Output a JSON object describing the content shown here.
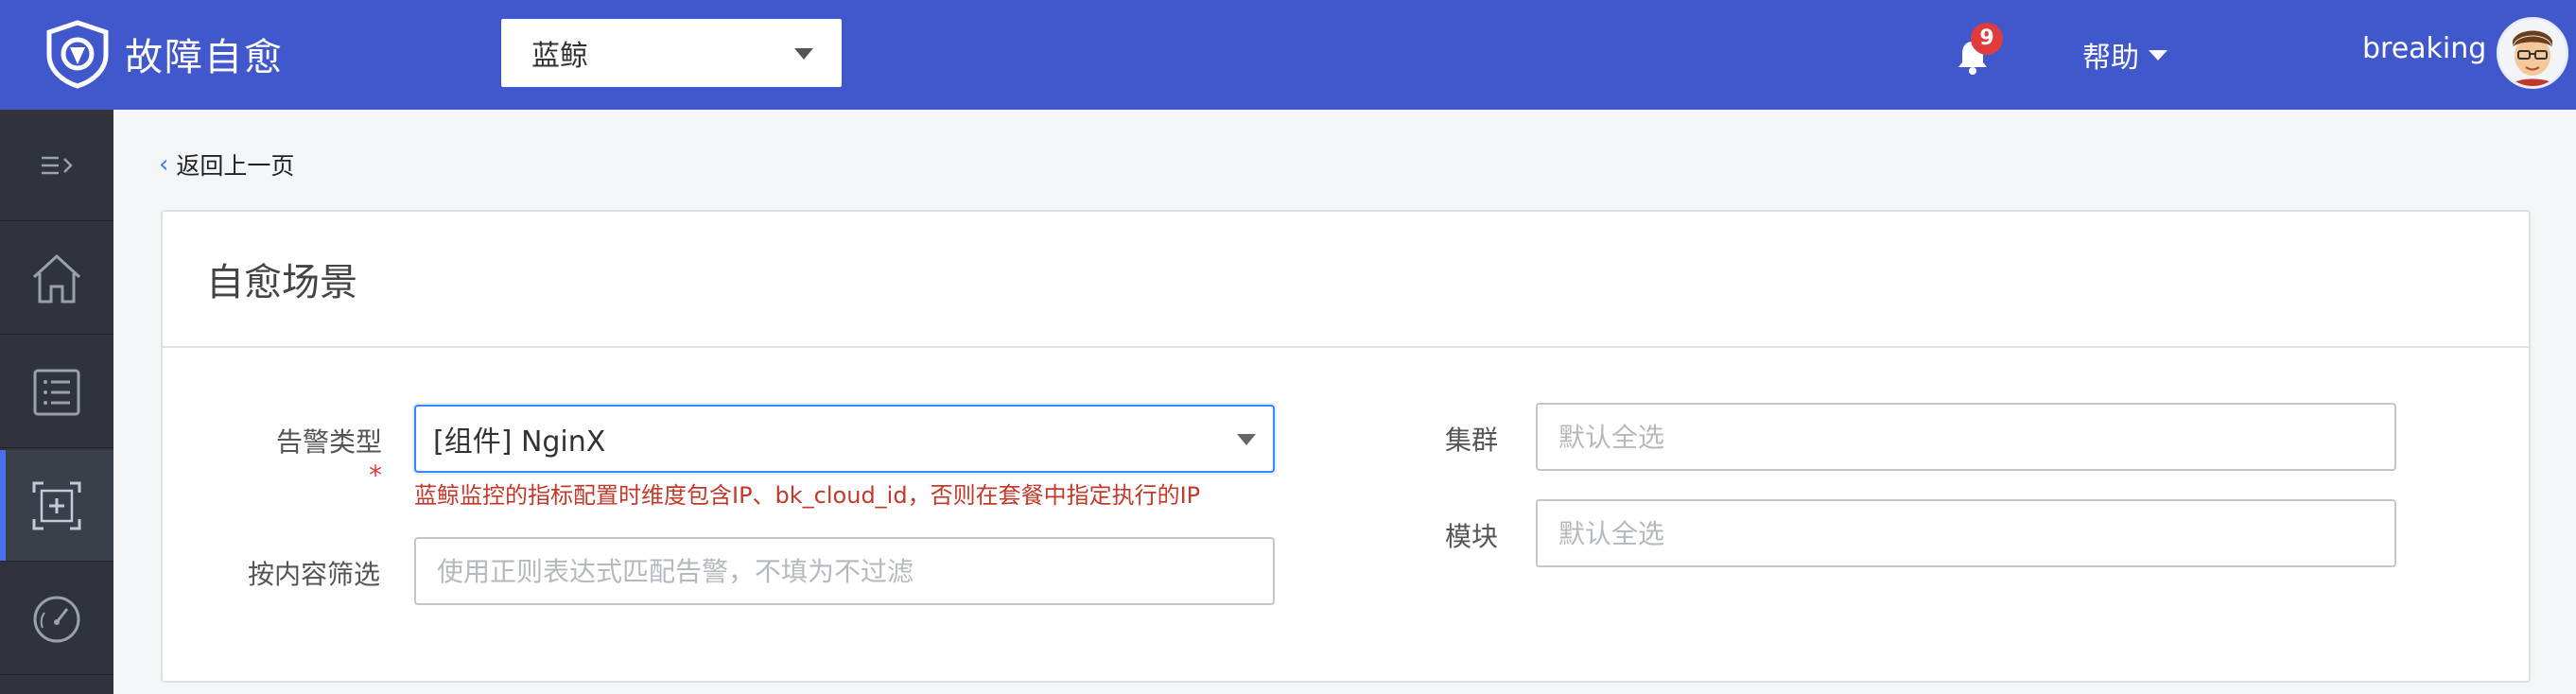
{
  "header": {
    "app_name": "故障自愈",
    "business_select": "蓝鲸",
    "notification_count": "9",
    "help_label": "帮助",
    "username": "breaking"
  },
  "sidebar": {
    "items": [
      {
        "icon": "menu-toggle-icon"
      },
      {
        "icon": "home-icon"
      },
      {
        "icon": "list-icon"
      },
      {
        "icon": "scene-icon",
        "active": true
      },
      {
        "icon": "dashboard-icon"
      }
    ]
  },
  "page": {
    "back_label": "返回上一页",
    "card_title": "自愈场景"
  },
  "form": {
    "alarm_type_label": "告警类型",
    "alarm_type_required": "*",
    "alarm_type_value": "[组件] NginX",
    "alarm_type_hint": "蓝鲸监控的指标配置时维度包含IP、bk_cloud_id，否则在套餐中指定执行的IP",
    "content_filter_label": "按内容筛选",
    "content_filter_placeholder": "使用正则表达式匹配告警，不填为不过滤",
    "cluster_label": "集群",
    "cluster_placeholder": "默认全选",
    "module_label": "模块",
    "module_placeholder": "默认全选"
  },
  "colors": {
    "topbar": "#4158cc",
    "sidebar": "#30333c",
    "accent": "#3a84ff",
    "error": "#c0392b"
  }
}
